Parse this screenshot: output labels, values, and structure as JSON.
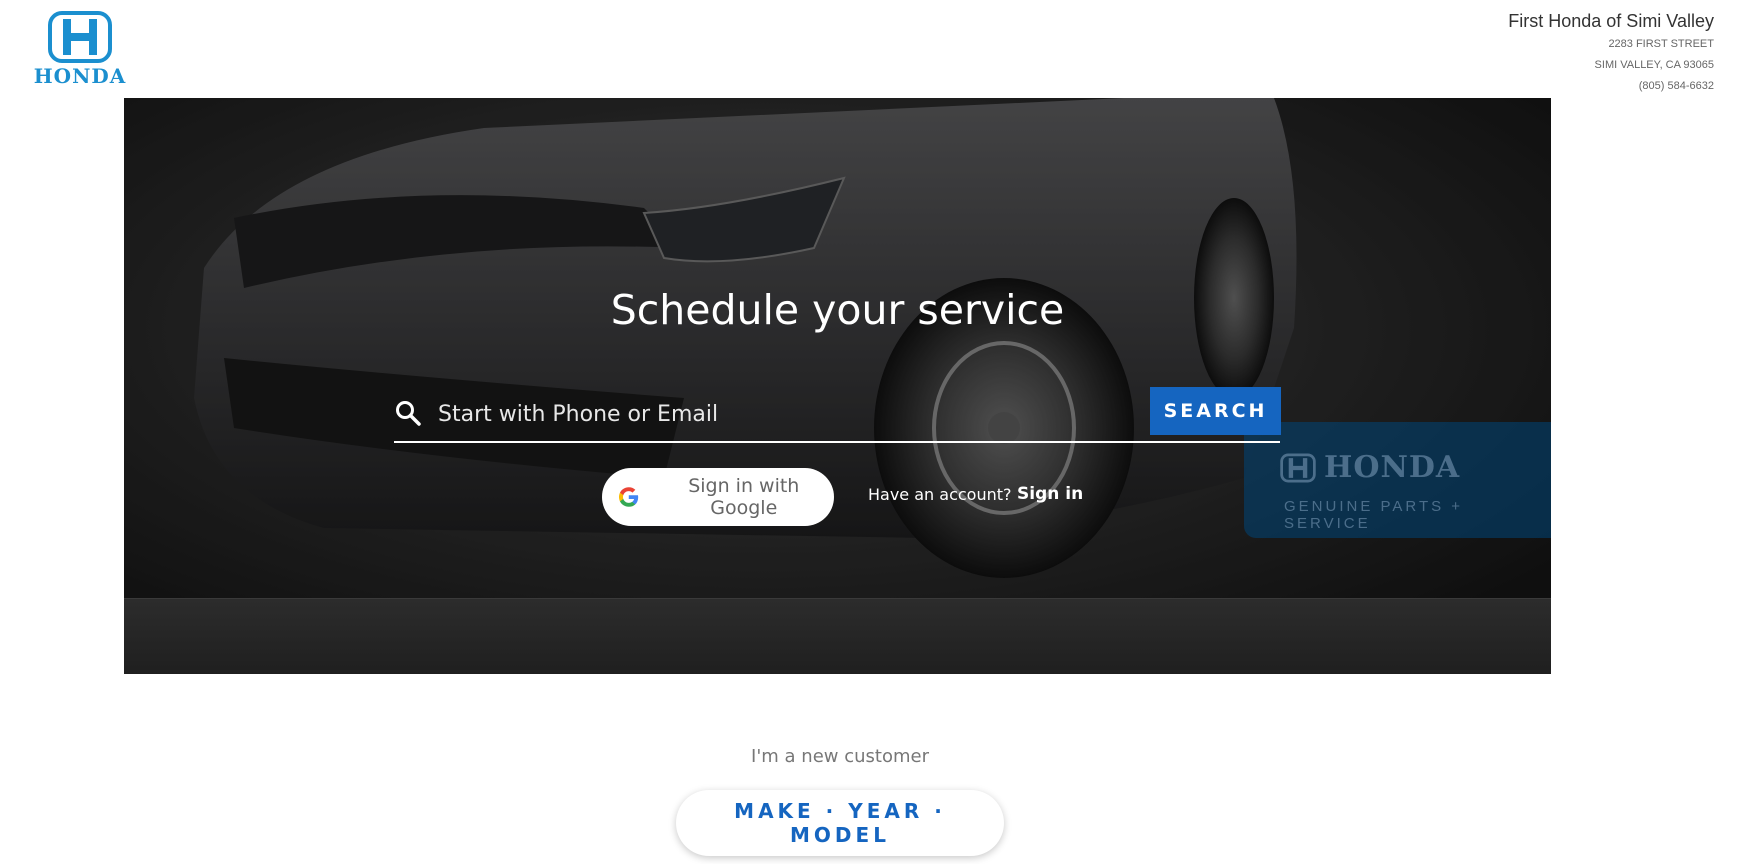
{
  "brand": {
    "logo_text": "HONDA",
    "color": "#1b8fcf"
  },
  "dealer": {
    "name": "First Honda of Simi Valley",
    "street": "2283 FIRST STREET",
    "city": "SIMI VALLEY, CA 93065",
    "phone": "(805) 584-6632"
  },
  "hero": {
    "title": "Schedule your service",
    "search_placeholder": "Start with Phone or Email",
    "search_value": "",
    "search_button": "SEARCH",
    "google_button": "Sign in with Google",
    "account_prompt": "Have an account?",
    "signin_link": "Sign in",
    "badge_logo": "HONDA",
    "badge_sub": "GENUINE PARTS + SERVICE",
    "accent_color": "#1565c0"
  },
  "new_customer": {
    "label": "I'm a new customer",
    "button": "MAKE · YEAR · MODEL"
  },
  "icons": [
    "honda-logo-icon",
    "search-icon",
    "google-icon",
    "honda-badge-icon"
  ]
}
